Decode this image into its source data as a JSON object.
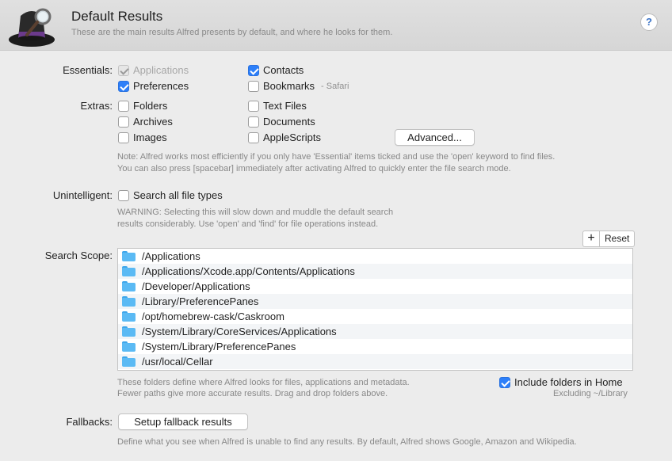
{
  "header": {
    "title": "Default Results",
    "subtitle": "These are the main results Alfred presents by default, and where he looks for them.",
    "help_label": "?"
  },
  "essentials": {
    "label": "Essentials:",
    "items": [
      {
        "label": "Applications",
        "checked": true,
        "disabled": true
      },
      {
        "label": "Contacts",
        "checked": true
      },
      {
        "label": "Preferences",
        "checked": true
      },
      {
        "label": "Bookmarks",
        "checked": false,
        "tag": "- Safari"
      }
    ]
  },
  "extras": {
    "label": "Extras:",
    "items": [
      {
        "label": "Folders",
        "checked": false
      },
      {
        "label": "Text Files",
        "checked": false
      },
      {
        "label": "Archives",
        "checked": false
      },
      {
        "label": "Documents",
        "checked": false
      },
      {
        "label": "Images",
        "checked": false
      },
      {
        "label": "AppleScripts",
        "checked": false
      }
    ],
    "advanced_button": "Advanced...",
    "note_line1": "Note: Alfred works most efficiently if you only have 'Essential' items ticked and use the 'open' keyword to find files.",
    "note_line2": "You can also press [spacebar] immediately after activating Alfred to quickly enter the file search mode."
  },
  "unintelligent": {
    "label": "Unintelligent:",
    "checkbox_label": "Search all file types",
    "checked": false,
    "warning_line1": "WARNING: Selecting this will slow down and muddle the default search",
    "warning_line2": "results considerably. Use 'open' and 'find' for file operations instead."
  },
  "search_scope": {
    "label": "Search Scope:",
    "add_label": "+",
    "reset_label": "Reset",
    "paths": [
      "/Applications",
      "/Applications/Xcode.app/Contents/Applications",
      "/Developer/Applications",
      "/Library/PreferencePanes",
      "/opt/homebrew-cask/Caskroom",
      "/System/Library/CoreServices/Applications",
      "/System/Library/PreferencePanes",
      "/usr/local/Cellar"
    ],
    "note_line1": "These folders define where Alfred looks for files, applications and metadata.",
    "note_line2": "Fewer paths give more accurate results. Drag and drop folders above.",
    "include_home_label": "Include folders in Home",
    "include_home_checked": true,
    "excluding_label": "Excluding ~/Library"
  },
  "fallbacks": {
    "label": "Fallbacks:",
    "button": "Setup fallback results",
    "note": "Define what you see when Alfred is unable to find any results. By default, Alfred shows Google, Amazon and Wikipedia."
  },
  "colors": {
    "accent": "#2d7ff9",
    "folder": "#5bbaf4"
  },
  "icons": {
    "logo": "alfred-hat-logo-icon",
    "folder": "folder-icon",
    "help": "help-icon"
  }
}
